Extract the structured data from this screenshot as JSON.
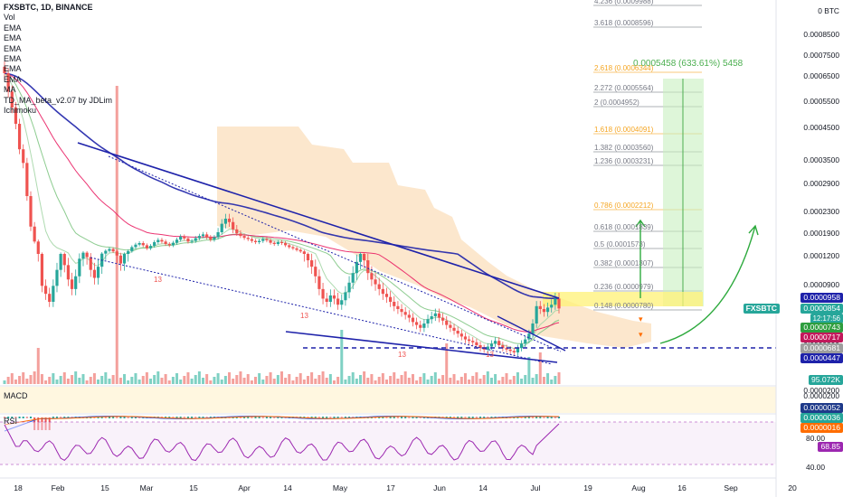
{
  "legend": {
    "title": "FXSBTC, 1D, BINANCE",
    "indicators": [
      "Vol",
      "EMA",
      "EMA",
      "EMA",
      "EMA",
      "EMA",
      "EMA",
      "MA",
      "TD_MA_beta_v2.07 by JDLim",
      "Ichimoku"
    ]
  },
  "macd_title": "MACD",
  "rsi_title": "RSI",
  "measure_text": "0.0005458 (633.61%) 5458",
  "fib_levels": [
    {
      "ratio": "4.236",
      "price": "0.0009988",
      "label": "4.236 (0.0009988)",
      "color": "#787b86"
    },
    {
      "ratio": "3.618",
      "price": "0.0008596",
      "label": "3.618 (0.0008596)",
      "color": "#787b86"
    },
    {
      "ratio": "2.618",
      "price": "0.0006344",
      "label": "2.618 (0.0006344)",
      "color": "#f5a623"
    },
    {
      "ratio": "2.272",
      "price": "0.0005564",
      "label": "2.272 (0.0005564)",
      "color": "#787b86"
    },
    {
      "ratio": "2",
      "price": "0.0004952",
      "label": "2 (0.0004952)",
      "color": "#787b86"
    },
    {
      "ratio": "1.618",
      "price": "0.0004091",
      "label": "1.618 (0.0004091)",
      "color": "#f5a623"
    },
    {
      "ratio": "1.382",
      "price": "0.0003560",
      "label": "1.382 (0.0003560)",
      "color": "#787b86"
    },
    {
      "ratio": "1.236",
      "price": "0.0003231",
      "label": "1.236 (0.0003231)",
      "color": "#787b86"
    },
    {
      "ratio": "0.786",
      "price": "0.0002212",
      "label": "0.786 (0.0002212)",
      "color": "#f5a623"
    },
    {
      "ratio": "0.618",
      "price": "0.0001839",
      "label": "0.618 (0.0001839)",
      "color": "#787b86"
    },
    {
      "ratio": "0.5",
      "price": "0.0001573",
      "label": "0.5 (0.0001573)",
      "color": "#787b86"
    },
    {
      "ratio": "0.382",
      "price": "0.0001307",
      "label": "0.382 (0.0001307)",
      "color": "#787b86"
    },
    {
      "ratio": "0.236",
      "price": "0.0000979",
      "label": "0.236 (0.0000979)",
      "color": "#787b86"
    },
    {
      "ratio": "0.148",
      "price": "0.0000780",
      "label": "0.148 (0.0000780)",
      "color": "#787b86"
    }
  ],
  "price_axis": [
    "0 BTC",
    "0.0008500",
    "0.0007500",
    "0.0006500",
    "0.0005500",
    "0.0004500",
    "0.0003500",
    "0.0002900",
    "0.0002300",
    "0.0001900",
    "0.0001200",
    "0.0000900",
    "0.0000500",
    "0.0000200"
  ],
  "macd_axis": [
    "0.0000200"
  ],
  "rsi_axis": [
    "80.00",
    "40.00"
  ],
  "time_axis": [
    "18",
    "Feb",
    "15",
    "Mar",
    "15",
    "Apr",
    "14",
    "May",
    "17",
    "Jun",
    "14",
    "Jul",
    "19",
    "Aug",
    "16",
    "Sep",
    "20"
  ],
  "symbol_tag": "FXSBTC",
  "price_labels": {
    "p1": {
      "text": "0.0000958",
      "color": "#1e22aa"
    },
    "p2": {
      "text": "0.0000854",
      "color": "#26a69a"
    },
    "countdown": "12:17:56",
    "p3": {
      "text": "0.0000743",
      "color": "#2e9e3e"
    },
    "p4": {
      "text": "0.0000717",
      "color": "#c2185b"
    },
    "p5": {
      "text": "0.0000681",
      "color": "#9e9e9e"
    },
    "p6": {
      "text": "0.0000447",
      "color": "#1e22aa"
    },
    "vol": {
      "text": "95.072K",
      "color": "#26a69a"
    },
    "m1": {
      "text": "0.0000052",
      "color": "#1e3a8a"
    },
    "m2": {
      "text": "0.0000036",
      "color": "#26a69a"
    },
    "m3": {
      "text": "0.0000016",
      "color": "#ff6d00"
    },
    "rsi": {
      "text": "68.85",
      "color": "#9c27b0"
    }
  },
  "td_marks": [
    "13",
    "13",
    "13",
    "13"
  ],
  "colors": {
    "up": "#26a69a",
    "down": "#ef5350",
    "trend": "#1e22aa",
    "cloud": "#fbe3c4",
    "target": "#c8f0c0",
    "highlight": "#fff176",
    "arrow": "#2eaa3e",
    "rsi": "#9c27b0",
    "macd_bg": "#fff7e0"
  },
  "chart_data": {
    "type": "candlestick",
    "symbol": "FXSBTC",
    "interval": "1D",
    "exchange": "BINANCE",
    "description": "Daily close estimated from the price axis",
    "close": [
      0.00065,
      0.00058,
      0.00052,
      0.00046,
      0.00038,
      0.00034,
      0.00026,
      0.0002,
      0.00016,
      0.00012,
      0.0001,
      9.5e-05,
      9e-05,
      0.0001,
      0.00011,
      0.00012,
      0.000113,
      0.000104,
      9.8e-05,
      0.000106,
      0.000117,
      0.000124,
      0.000118,
      0.00011,
      0.000105,
      0.000112,
      0.000121,
      0.00013,
      0.000136,
      0.000128,
      0.000119,
      0.000114,
      0.00012,
      0.000129,
      0.000142,
      0.00015,
      0.000155,
      0.000148,
      0.000138,
      0.000146,
      0.000158,
      0.000165,
      0.00016,
      0.000152,
      0.000148,
      0.000156,
      0.000166,
      0.000176,
      0.00017,
      0.00016,
      0.000162,
      0.000171,
      0.000178,
      0.000183,
      0.000174,
      0.000166,
      0.000174,
      0.00019,
      0.000205,
      0.000214,
      0.000208,
      0.000195,
      0.000186,
      0.000178,
      0.000172,
      0.000168,
      0.000162,
      0.000158,
      0.000162,
      0.000168,
      0.000164,
      0.000156,
      0.000152,
      0.000158,
      0.000155,
      0.000148,
      0.000142,
      0.000138,
      0.000133,
      0.000128,
      0.00012,
      0.000116,
      0.000112,
      0.000106,
      9.8e-05,
      9.2e-05,
      9e-05,
      9.4e-05,
      9.2e-05,
      8.8e-05,
      9.1e-05,
      9.6e-05,
      0.000102,
      0.000108,
      0.000115,
      0.00012,
      0.000116,
      0.000108,
      0.000104,
      0.000101,
      9.8e-05,
      9.5e-05,
      9.3e-05,
      9e-05,
      8.7e-05,
      8.5e-05,
      8.3e-05,
      8.1e-05,
      7.9e-05,
      7.6e-05,
      7.4e-05,
      7.2e-05,
      7.5e-05,
      7.8e-05,
      8e-05,
      8.2e-05,
      7.9e-05,
      7.7e-05,
      7.4e-05,
      7.2e-05,
      7e-05,
      6.8e-05,
      6.6e-05,
      6.4e-05,
      6.3e-05,
      6.2e-05,
      6e-05,
      5.8e-05,
      5.7e-05,
      5.9e-05,
      6.1e-05,
      6.3e-05,
      6e-05,
      5.8e-05,
      5.7e-05,
      5.6e-05,
      5.5e-05,
      5.8e-05,
      6.1e-05,
      6.4e-05,
      6.8e-05,
      7.5e-05,
      8.7e-05,
      8.5e-05,
      8.3e-05,
      8.6e-05,
      8.8e-05,
      9.2e-05,
      8.54e-05
    ],
    "trendlines": "descending wedge with breakout",
    "measure": {
      "target": "0.0005458",
      "percent": "633.61%"
    },
    "ylabel": "BTC"
  }
}
